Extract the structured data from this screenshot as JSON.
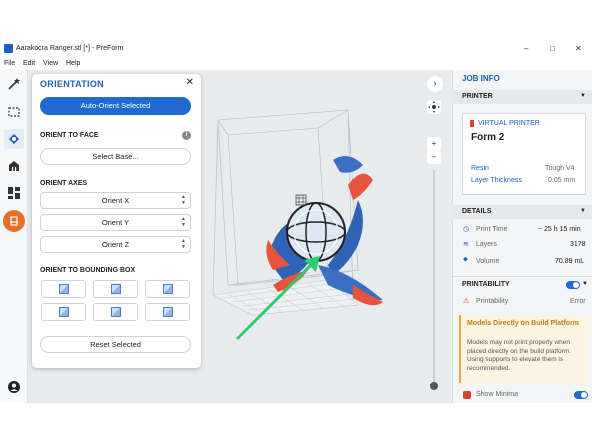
{
  "window": {
    "title": "Aarakocra Ranger.stl [*] - PreForm",
    "controls": [
      "–",
      "□",
      "✕"
    ]
  },
  "menu": [
    "File",
    "Edit",
    "View",
    "Help"
  ],
  "tools": [
    "magic-wand-icon",
    "select-box-icon",
    "orientation-icon",
    "supports-icon",
    "layout-icon",
    "print-icon",
    "account-icon"
  ],
  "orientation_panel": {
    "title": "ORIENTATION",
    "close": "✕",
    "auto_orient": "Auto-Orient Selected",
    "orient_to_face": "ORIENT TO FACE",
    "select_base": "Select Base...",
    "orient_axes": "ORIENT AXES",
    "axes": [
      "Orient X",
      "Orient Y",
      "Orient Z"
    ],
    "orient_bbox": "ORIENT TO BOUNDING BOX",
    "reset": "Reset Selected"
  },
  "job_info": {
    "title": "JOB INFO",
    "printer_header": "PRINTER",
    "printer_type": "VIRTUAL PRINTER",
    "printer_name": "Form 2",
    "resin_label": "Resin",
    "resin_value": "Tough V4",
    "layer_label": "Layer Thickness",
    "layer_value": "0.05 mm",
    "details_header": "DETAILS",
    "print_time_label": "Print Time",
    "print_time_value": "~ 25 h 15 min",
    "layers_label": "Layers",
    "layers_value": "3178",
    "volume_label": "Volume",
    "volume_value": "70.89 mL",
    "printability_header": "PRINTABILITY",
    "printability_label": "Printability",
    "printability_value": "Error",
    "warning_title": "Models Directly on Build Platform",
    "warning_body": "Models may not print properly when placed directly on the build platform. Using supports to elevate them is recommended.",
    "show_minima": "Show Minima"
  },
  "colors": {
    "accent": "#1f6ad1",
    "warning": "#f0a23a",
    "arrow": "#2ecc71"
  }
}
